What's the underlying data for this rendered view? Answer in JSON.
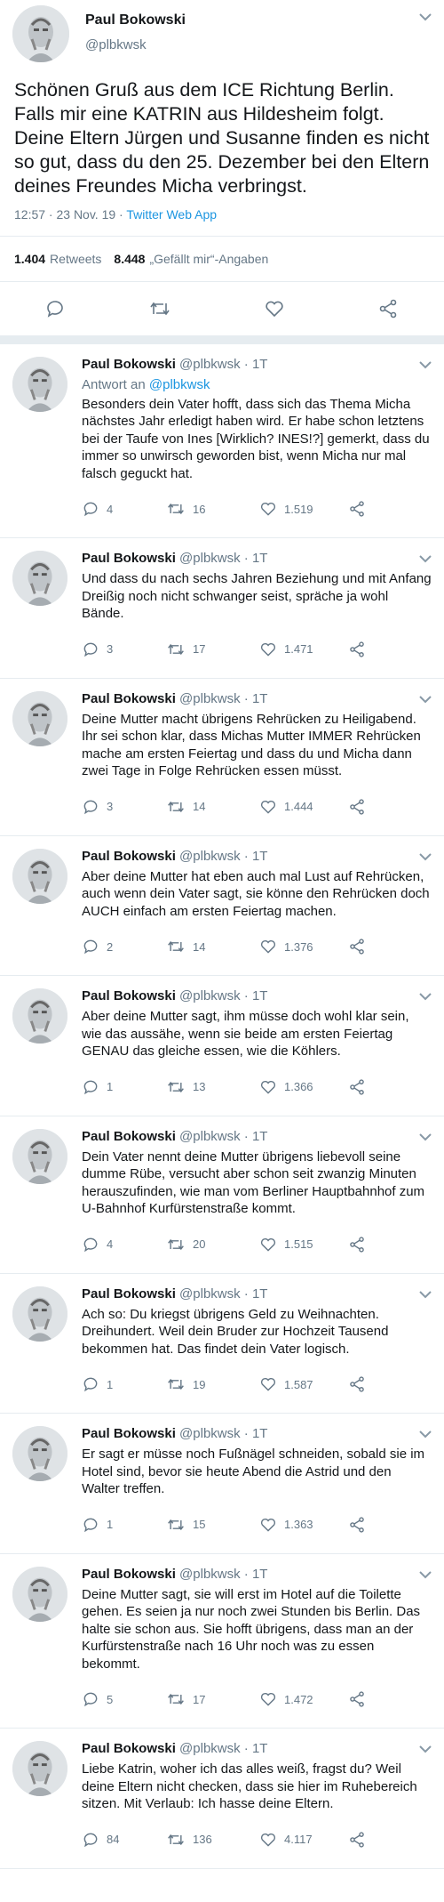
{
  "main": {
    "name": "Paul Bokowski",
    "handle": "@plbkwsk",
    "text": "Schönen Gruß aus dem ICE Richtung Berlin. Falls mir eine KATRIN aus Hildesheim folgt. Deine Eltern Jürgen und Susanne finden es nicht so gut, dass du den 25. Dezember bei den Eltern deines Freundes Micha verbringst.",
    "timestamp": "12:57 · 23 Nov. 19 · ",
    "source": "Twitter Web App",
    "retweets_count": "1.404",
    "retweets_label": "Retweets",
    "likes_count": "8.448",
    "likes_label": "„Gefällt mir“-Angaben"
  },
  "replies": [
    {
      "name": "Paul Bokowski",
      "handle": "@plbkwsk · 1T",
      "reply_to_prefix": "Antwort an ",
      "reply_to_handle": "@plbkwsk",
      "text": "Besonders dein Vater hofft, dass sich das Thema Micha nächstes Jahr erledigt haben wird. Er habe schon letztens bei der Taufe von Ines [Wirklich? INES!?] gemerkt, dass du immer so unwirsch geworden bist, wenn Micha nur mal falsch geguckt hat.",
      "replies": "4",
      "retweets": "16",
      "likes": "1.519"
    },
    {
      "name": "Paul Bokowski",
      "handle": "@plbkwsk · 1T",
      "text": "Und dass du nach sechs Jahren Beziehung und mit Anfang Dreißig noch nicht schwanger seist, spräche ja wohl Bände.",
      "replies": "3",
      "retweets": "17",
      "likes": "1.471"
    },
    {
      "name": "Paul Bokowski",
      "handle": "@plbkwsk · 1T",
      "text": "Deine Mutter macht übrigens Rehrücken zu Heiligabend. Ihr sei schon klar, dass Michas Mutter IMMER Rehrücken mache am ersten Feiertag und dass du und Micha dann zwei Tage in Folge Rehrücken essen müsst.",
      "replies": "3",
      "retweets": "14",
      "likes": "1.444"
    },
    {
      "name": "Paul Bokowski",
      "handle": "@plbkwsk · 1T",
      "text": "Aber deine Mutter hat eben auch mal Lust auf Rehrücken, auch wenn dein Vater sagt, sie könne den Rehrücken doch AUCH einfach am ersten Feiertag machen.",
      "replies": "2",
      "retweets": "14",
      "likes": "1.376"
    },
    {
      "name": "Paul Bokowski",
      "handle": "@plbkwsk · 1T",
      "text": "Aber deine Mutter sagt, ihm müsse doch wohl klar sein, wie das aussähe, wenn sie beide am ersten Feiertag GENAU das gleiche essen, wie die Köhlers.",
      "replies": "1",
      "retweets": "13",
      "likes": "1.366"
    },
    {
      "name": "Paul Bokowski",
      "handle": "@plbkwsk · 1T",
      "text": "Dein Vater nennt deine Mutter übrigens liebevoll seine dumme Rübe, versucht aber schon seit zwanzig Minuten herauszufinden, wie man vom Berliner Hauptbahnhof zum U-Bahnhof Kurfürstenstraße kommt.",
      "replies": "4",
      "retweets": "20",
      "likes": "1.515"
    },
    {
      "name": "Paul Bokowski",
      "handle": "@plbkwsk · 1T",
      "text": "Ach so: Du kriegst übrigens Geld zu Weihnachten. Dreihundert. Weil dein Bruder zur Hochzeit Tausend bekommen hat. Das findet dein Vater logisch.",
      "replies": "1",
      "retweets": "19",
      "likes": "1.587"
    },
    {
      "name": "Paul Bokowski",
      "handle": "@plbkwsk · 1T",
      "text": "Er sagt er müsse noch Fußnägel schneiden, sobald sie im Hotel sind, bevor sie heute Abend die Astrid und den Walter treffen.",
      "replies": "1",
      "retweets": "15",
      "likes": "1.363"
    },
    {
      "name": "Paul Bokowski",
      "handle": "@plbkwsk · 1T",
      "text": "Deine Mutter sagt, sie will erst im Hotel auf die Toilette gehen. Es seien ja nur noch zwei Stunden bis Berlin. Das halte sie schon aus. Sie hofft übrigens, dass man an der Kurfürstenstraße nach 16 Uhr noch was zu essen bekommt.",
      "replies": "5",
      "retweets": "17",
      "likes": "1.472"
    },
    {
      "name": "Paul Bokowski",
      "handle": "@plbkwsk · 1T",
      "text": "Liebe Katrin, woher ich das alles weiß, fragst du? Weil deine Eltern nicht checken, dass sie hier im Ruhebereich sitzen. Mit Verlaub: Ich hasse deine Eltern.",
      "replies": "84",
      "retweets": "136",
      "likes": "4.117"
    }
  ],
  "icons": {
    "reply": "reply-icon",
    "retweet": "retweet-icon",
    "like": "heart-icon",
    "share": "share-icon",
    "menu": "chevron-down-icon"
  },
  "colors": {
    "link": "#1b95e0",
    "muted": "#657786",
    "text": "#14171a",
    "border": "#e6ecf0"
  }
}
